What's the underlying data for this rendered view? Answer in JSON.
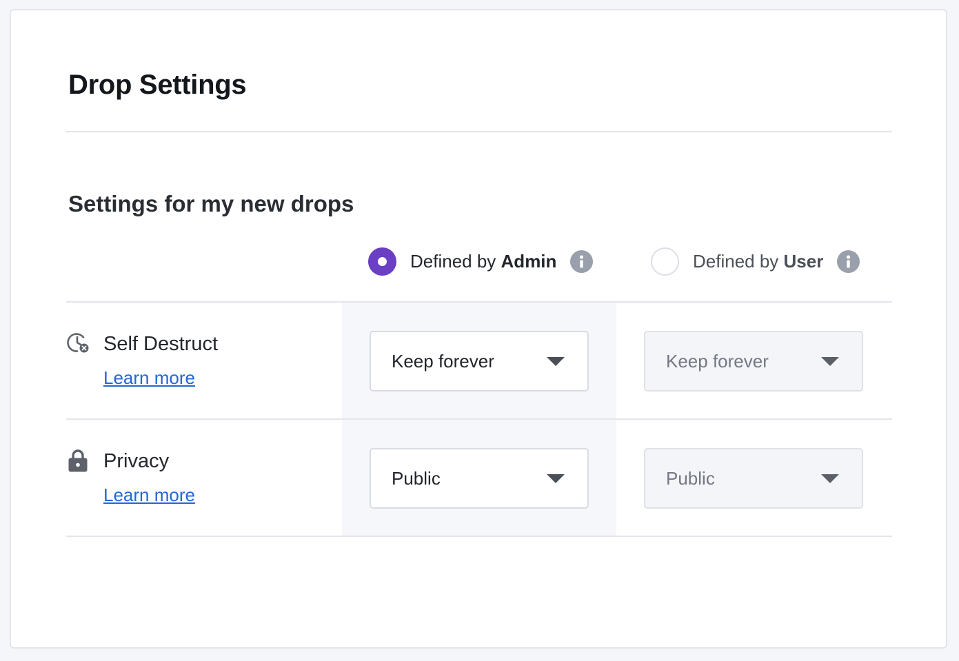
{
  "page": {
    "title": "Drop Settings",
    "section_title": "Settings for my new drops"
  },
  "options": {
    "admin": {
      "prefix": "Defined by ",
      "emphasis": "Admin",
      "selected": true,
      "info_icon": "info-icon"
    },
    "user": {
      "prefix": "Defined by ",
      "emphasis": "User",
      "selected": false,
      "info_icon": "info-icon"
    }
  },
  "rows": [
    {
      "label": "Self Destruct",
      "icon": "clock-cancel-icon",
      "link": "Learn more",
      "admin_value": "Keep forever",
      "user_value": "Keep forever"
    },
    {
      "label": "Privacy",
      "icon": "lock-icon",
      "link": "Learn more",
      "admin_value": "Public",
      "user_value": "Public"
    }
  ],
  "colors": {
    "accent": "#6a3fc4",
    "link": "#2266d8",
    "info": "#9aa0ab"
  }
}
